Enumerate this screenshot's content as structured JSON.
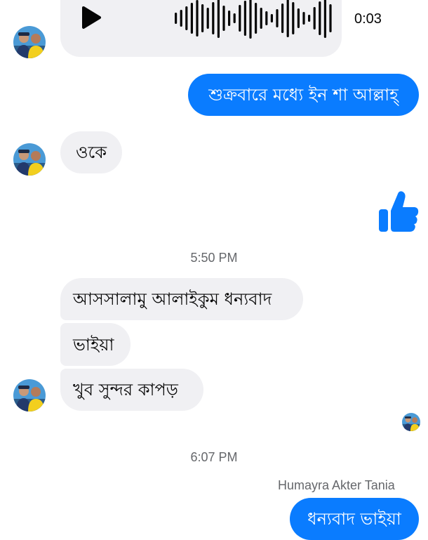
{
  "thread": {
    "voice_message": {
      "duration": "0:03",
      "play_icon": "play-icon"
    },
    "messages": [
      {
        "from": "contact",
        "text": ""
      },
      {
        "from": "me",
        "text": "শুক্রবারে মধ্যে ইন শা আল্লাহ্"
      },
      {
        "from": "contact",
        "text": "ওকে"
      },
      {
        "from": "me",
        "icon": "thumbs-up-icon",
        "color": "#0a7cff"
      }
    ],
    "timestamp_1": "5:50 PM",
    "group_1": [
      "আসসালামু আলাইকুম ধন্যবাদ",
      "ভাইয়া",
      "খুব সুন্দর কাপড়"
    ],
    "timestamp_2": "6:07 PM",
    "sender_name": "Humayra Akter Tania",
    "last_message": "ধন্যবাদ ভাইয়া"
  },
  "colors": {
    "outgoing_bubble": "#0a7cff",
    "incoming_bubble": "#f0f0f3",
    "meta_text": "#65676b"
  }
}
